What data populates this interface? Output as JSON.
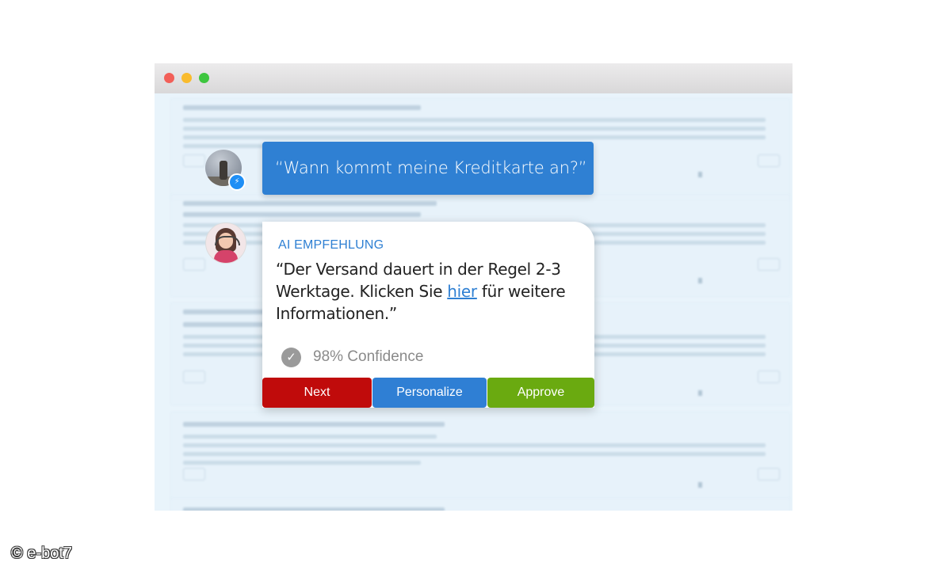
{
  "question": {
    "text": "“Wann kommt meine Kreditkarte an?”"
  },
  "ai_card": {
    "label": "AI EMPFEHLUNG",
    "message_before_link": "“Der Versand dauert in der Regel 2-3 Werktage. Klicken Sie ",
    "link_text": "hier",
    "message_after_link": " für weitere Informationen.”",
    "confidence": "98% Confidence"
  },
  "buttons": {
    "next": "Next",
    "personalize": "Personalize",
    "approve": "Approve"
  },
  "copyright": "© e-bot7",
  "colors": {
    "brand_blue": "#2f80d3",
    "next_red": "#c00b0b",
    "approve_green": "#6aaa10",
    "messenger_blue": "#1e8ef5"
  },
  "icons": {
    "check": "check-circle-icon",
    "messenger": "messenger-icon"
  }
}
